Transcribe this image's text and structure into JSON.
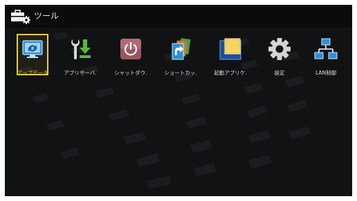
{
  "window": {
    "title": "ツール",
    "title_icon": "toolbox-gear-icon"
  },
  "apps": [
    {
      "label": "アップデータ",
      "icon": "update-screen-icon",
      "selected": true
    },
    {
      "label": "アプリサーバ.",
      "icon": "wrench-download-icon",
      "selected": false
    },
    {
      "label": "シャットダウ.",
      "icon": "power-icon",
      "selected": false
    },
    {
      "label": "ショートカッ.",
      "icon": "shortcut-icon",
      "selected": false
    },
    {
      "label": "起動アプリケ.",
      "icon": "startup-app-icon",
      "selected": false
    },
    {
      "label": "設定",
      "icon": "gear-icon",
      "selected": false
    },
    {
      "label": "LAN制御",
      "icon": "lan-network-icon",
      "selected": false
    }
  ],
  "colors": {
    "background": "#111214",
    "selection": "#e6cf44",
    "accent_blue": "#2e8fd8",
    "accent_green": "#58b83a"
  }
}
